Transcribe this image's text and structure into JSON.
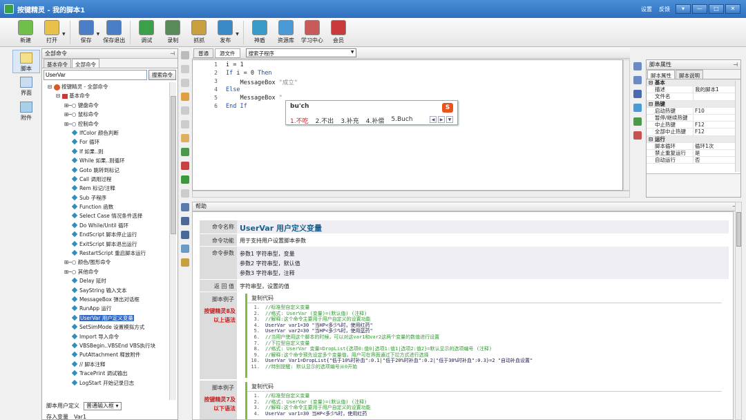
{
  "window": {
    "title": "按键精灵 - 我的脚本1",
    "links": [
      "设置",
      "反馈"
    ],
    "controls": [
      "▾",
      "—",
      "□",
      "✕"
    ]
  },
  "toolbar": {
    "buttons": [
      {
        "label": "新建",
        "icon": "new-file-icon",
        "color": "#6fbf4a"
      },
      {
        "label": "打开",
        "icon": "open-folder-icon",
        "color": "#e8c04a"
      },
      {
        "label": "保存",
        "icon": "save-icon",
        "color": "#4a7fc8"
      },
      {
        "label": "保存退出",
        "icon": "save-exit-icon",
        "color": "#4a7fc8"
      },
      {
        "label": "调试",
        "icon": "debug-icon",
        "color": "#3aa04a"
      },
      {
        "label": "录制",
        "icon": "record-icon",
        "color": "#5a8a5a"
      },
      {
        "label": "抓抓",
        "icon": "grab-icon",
        "color": "#c8a040"
      },
      {
        "label": "发布",
        "icon": "publish-icon",
        "color": "#3a8ac8"
      },
      {
        "label": "神盾",
        "icon": "shield-icon",
        "color": "#3a9ac8"
      },
      {
        "label": "资源库",
        "icon": "resource-icon",
        "color": "#4a9ad8"
      },
      {
        "label": "学习中心",
        "icon": "learn-center-icon",
        "color": "#c85a5a"
      },
      {
        "label": "会员",
        "icon": "member-icon",
        "color": "#c83a3a"
      }
    ]
  },
  "lefttabs": [
    {
      "label": "脚本",
      "icon": "script-icon"
    },
    {
      "label": "界面",
      "icon": "ui-icon"
    },
    {
      "label": "附件",
      "icon": "attachment-icon"
    }
  ],
  "cmdpanel": {
    "title": "全部命令",
    "pin": "⊣",
    "tabs": [
      "基本命令",
      "全部命令"
    ],
    "search_value": "UserVar",
    "search_button": "搜索命令",
    "tree": [
      {
        "text": "按键精灵 - 全部命令",
        "level": 0,
        "kind": "root"
      },
      {
        "text": "基本命令",
        "level": 1,
        "kind": "group"
      },
      {
        "text": "键盘命令",
        "level": 2,
        "kind": "folder"
      },
      {
        "text": "鼠标命令",
        "level": 2,
        "kind": "folder"
      },
      {
        "text": "控制命令",
        "level": 2,
        "kind": "folder"
      },
      {
        "text": "IfColor 颜色判断",
        "level": 3,
        "kind": "item"
      },
      {
        "text": "For 循环",
        "level": 3,
        "kind": "item"
      },
      {
        "text": "If 如果..则",
        "level": 3,
        "kind": "item"
      },
      {
        "text": "While 如果..则循环",
        "level": 3,
        "kind": "item"
      },
      {
        "text": "Goto 跳转到标记",
        "level": 3,
        "kind": "item"
      },
      {
        "text": "Call 调用过程",
        "level": 3,
        "kind": "item"
      },
      {
        "text": "Rem 标记/注释",
        "level": 3,
        "kind": "item"
      },
      {
        "text": "Sub 子程序",
        "level": 3,
        "kind": "item"
      },
      {
        "text": "Function 函数",
        "level": 3,
        "kind": "item"
      },
      {
        "text": "Select Case 情况条件选择",
        "level": 3,
        "kind": "item"
      },
      {
        "text": "Do While/Until 循环",
        "level": 3,
        "kind": "item"
      },
      {
        "text": "EndScript 脚本停止运行",
        "level": 3,
        "kind": "item"
      },
      {
        "text": "ExitScript 脚本退出运行",
        "level": 3,
        "kind": "item"
      },
      {
        "text": "RestartScript 重启脚本运行",
        "level": 3,
        "kind": "item"
      },
      {
        "text": "颜色/图形命令",
        "level": 2,
        "kind": "folder"
      },
      {
        "text": "其他命令",
        "level": 2,
        "kind": "folder"
      },
      {
        "text": "Delay 延时",
        "level": 3,
        "kind": "item"
      },
      {
        "text": "SayString 输入文本",
        "level": 3,
        "kind": "item"
      },
      {
        "text": "MessageBox 弹出对话框",
        "level": 3,
        "kind": "item"
      },
      {
        "text": "RunApp 运行",
        "level": 3,
        "kind": "item"
      },
      {
        "text": "UserVar 用户定义变量",
        "level": 3,
        "kind": "item",
        "selected": true
      },
      {
        "text": "SetSimMode 设置模拟方式",
        "level": 3,
        "kind": "item"
      },
      {
        "text": "Import 导入命令",
        "level": 3,
        "kind": "item"
      },
      {
        "text": "VBSBegin..VBSEnd VBS执行块",
        "level": 3,
        "kind": "item"
      },
      {
        "text": "PutAttachment 释放附件",
        "level": 3,
        "kind": "item"
      },
      {
        "text": "// 脚本注释",
        "level": 3,
        "kind": "item"
      },
      {
        "text": "TracePrint 调试输出",
        "level": 3,
        "kind": "item"
      },
      {
        "text": "LogStart 开始记录日志",
        "level": 3,
        "kind": "item"
      }
    ],
    "bottom": {
      "row1_label": "脚本用户定义",
      "row1_select": "普通输入框",
      "row2_label": "存入变量",
      "row2_value": "Var1"
    }
  },
  "editor": {
    "tabs": [
      "普通",
      "源文件"
    ],
    "search_placeholder": "搜索子程序",
    "lines": [
      {
        "n": "1",
        "code": "i = 1"
      },
      {
        "n": "2",
        "code": "If i = 0 Then"
      },
      {
        "n": "3",
        "code": "    MessageBox \"成立\""
      },
      {
        "n": "4",
        "code": "Else"
      },
      {
        "n": "5",
        "code": "    MessageBox \""
      },
      {
        "n": "6",
        "code": "End If"
      }
    ],
    "ime": {
      "pinyin": "bu'ch",
      "candidates": [
        "1.不吃",
        "2.不出",
        "3.补充",
        "4.补偿",
        "5.Buch"
      ],
      "logo": "S"
    }
  },
  "properties": {
    "title": "脚本属性",
    "pin": "⊣",
    "tabs": [
      "脚本属性",
      "脚本说明"
    ],
    "rows": [
      {
        "k": "基本",
        "v": "",
        "cat": true
      },
      {
        "k": "描述",
        "v": "我的脚本1"
      },
      {
        "k": "文件名",
        "v": ""
      },
      {
        "k": "热键",
        "v": "",
        "cat": true
      },
      {
        "k": "启动热键",
        "v": "F10"
      },
      {
        "k": "暂停/继续热键",
        "v": ""
      },
      {
        "k": "中止热键",
        "v": "F12"
      },
      {
        "k": "全部中止热键",
        "v": "F12"
      },
      {
        "k": "运行",
        "v": "",
        "cat": true
      },
      {
        "k": "脚本循环",
        "v": "循环1次"
      },
      {
        "k": "禁止重复运行",
        "v": "是"
      },
      {
        "k": "自动运行",
        "v": "否"
      }
    ]
  },
  "help": {
    "title": "帮助",
    "pin": "⊣",
    "name_label": "命令名称",
    "name_value": "UserVar 用户定义变量",
    "func_label": "命令功能",
    "func_value": "用于支持用户设置脚本参数",
    "params_label": "命令参数",
    "params": [
      "参数1 字符串型，变量",
      "参数2 字符串型，默认值",
      "参数3 字符串型，注释"
    ],
    "return_label": "返 回 值",
    "return_value": "字符串型，设置的值",
    "example_label": "脚本例子",
    "copy_label": "复制代码",
    "ex1_tag": "按键精灵8及以上语法",
    "ex1_lines": [
      "//标准型自定义变量",
      "//格式: UserVar (变量)=(默认值) (注释)",
      "//解释:这个命令主要用于用户自定义的设置功能",
      "UserVar var1=30 \"当HP<多少%时，使用红药\"",
      "UserVar var2=30 \"当HP<多少%时，使用蓝药\"",
      "//当用户使用这个脚本的时候，可以对这var1和var2这两个变量的数值进行设置",
      "//下拉型自定义变量",
      "//格式: UserVar 变量=DropList{选项0:值0|选项1:值1|选项2:值2}=默认显示的选项编号 (注释)",
      "//解释:这个命令预先设定多个变量值，用户可在界面通过下拉方式进行选择",
      "UserVar Var1=DropList{\"低于10%时补血\":0.1|\"低于20%时补血\":0.2|\"低于30%时补血\":0.3}=2 \"自动补血设置\"",
      "//特别提醒: 默认显示的选项编号从0开始"
    ],
    "ex2_tag": "按键精灵7及以下语法",
    "ex2_lines": [
      "//标准型自定义变量",
      "//格式: UserVar (变量)=(默认值) (注释)",
      "//解释:这个命令主要用于用户自定义的设置功能",
      "UserVar var1=30 当HP<多少%时，使用红药"
    ]
  }
}
